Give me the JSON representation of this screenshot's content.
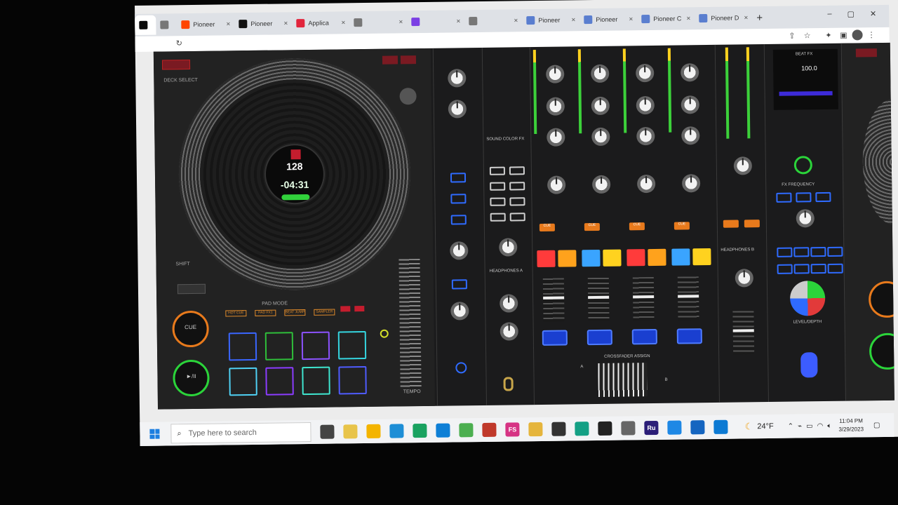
{
  "browser": {
    "tabs": [
      {
        "label": "",
        "color": "#0a0a0a",
        "icon": "pioneer-app-icon"
      },
      {
        "label": "",
        "color": "#777777",
        "icon": "globe-icon"
      },
      {
        "label": "Pioneer",
        "color": "#ff4500",
        "icon": "reddit-icon"
      },
      {
        "label": "Pioneer",
        "color": "#111111",
        "icon": "pioneer-icon"
      },
      {
        "label": "Applica",
        "color": "#e2253c",
        "icon": "app-icon"
      },
      {
        "label": "",
        "color": "#777777",
        "icon": "globe-icon"
      },
      {
        "label": "",
        "color": "#7b3fe4",
        "icon": "mail-icon"
      },
      {
        "label": "",
        "color": "#777777",
        "icon": "loading-icon"
      },
      {
        "label": "Pioneer",
        "color": "#5a7ecf",
        "icon": "pioneer-z-icon"
      },
      {
        "label": "Pioneer",
        "color": "#5a7ecf",
        "icon": "pioneer-z-icon"
      },
      {
        "label": "Pioneer C",
        "color": "#5a7ecf",
        "icon": "pioneer-z-icon"
      },
      {
        "label": "Pioneer D",
        "color": "#5a7ecf",
        "icon": "pioneer-z-icon"
      }
    ],
    "new_tab": "+",
    "close_glyph": "×"
  },
  "controller": {
    "jog_bpm": "128",
    "jog_time": "-04:31",
    "shift_label": "SHIFT",
    "cue_label": "CUE",
    "play_label": "►/II",
    "tempo_label": "TEMPO",
    "pad_mode_label": "PAD MODE",
    "mode_buttons": [
      "HOT CUE",
      "PAD FX1",
      "BEAT JUMP",
      "SAMPLER"
    ],
    "sound_color_fx": "SOUND COLOR FX",
    "headphones_a": "HEADPHONES A",
    "headphones_b": "HEADPHONES B",
    "beat_fx": "BEAT FX",
    "beat_fx_value": "100.0",
    "fx_frequency": "FX FREQUENCY",
    "crossfader_assign": "CROSSFADER ASSIGN",
    "cue_buttons": [
      "CUE",
      "CUE",
      "CUE",
      "CUE"
    ],
    "level_depth": "LEVEL/DEPTH",
    "channel_labels": [
      "A",
      "B"
    ]
  },
  "taskbar": {
    "search_placeholder": "Type here to search",
    "weather": "24°F",
    "time": "11:04 PM",
    "date": "3/29/2023",
    "apps": [
      {
        "name": "task-view",
        "color": "#444444",
        "text": ""
      },
      {
        "name": "notepad",
        "color": "#e8c44a",
        "text": ""
      },
      {
        "name": "file-explorer",
        "color": "#f4b400",
        "text": ""
      },
      {
        "name": "mail",
        "color": "#1e8ed6",
        "text": ""
      },
      {
        "name": "chrome",
        "color": "#1aa260",
        "text": ""
      },
      {
        "name": "edge",
        "color": "#0e7fd6",
        "text": ""
      },
      {
        "name": "photos",
        "color": "#4caf50",
        "text": ""
      },
      {
        "name": "music",
        "color": "#c0392b",
        "text": ""
      },
      {
        "name": "fs",
        "color": "#d63384",
        "text": "FS"
      },
      {
        "name": "paint",
        "color": "#e5b53d",
        "text": ""
      },
      {
        "name": "globe",
        "color": "#333333",
        "text": ""
      },
      {
        "name": "app-teal",
        "color": "#14a085",
        "text": ""
      },
      {
        "name": "snip",
        "color": "#222222",
        "text": ""
      },
      {
        "name": "camera",
        "color": "#666666",
        "text": ""
      },
      {
        "name": "ru",
        "color": "#2b1e78",
        "text": "Ru"
      },
      {
        "name": "download",
        "color": "#1e88e5",
        "text": ""
      },
      {
        "name": "star-app",
        "color": "#1565c0",
        "text": ""
      },
      {
        "name": "photos-blue",
        "color": "#0d7ad3",
        "text": ""
      }
    ]
  }
}
